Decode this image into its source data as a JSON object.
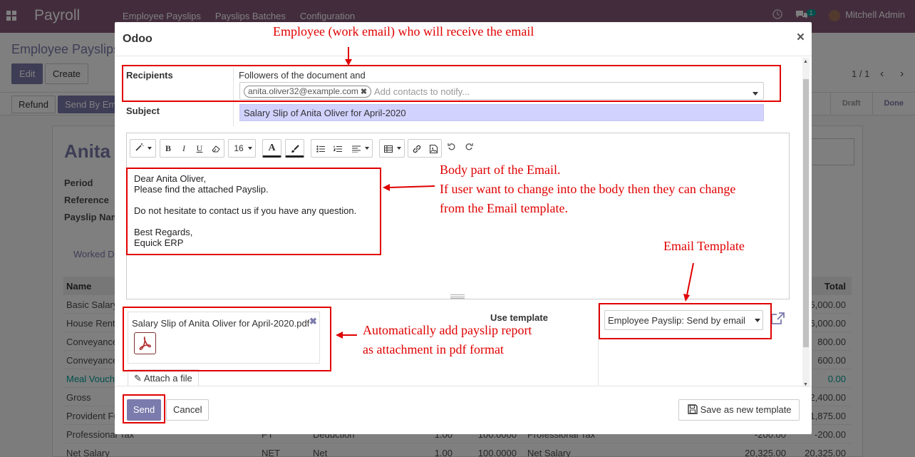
{
  "app": {
    "brand": "Payroll",
    "menu": [
      "Employee Payslips",
      "Payslips Batches",
      "Configuration"
    ],
    "chat_count": "1",
    "user": "Mitchell Admin"
  },
  "control_panel": {
    "breadcrumb": "Employee Payslips",
    "edit_label": "Edit",
    "create_label": "Create",
    "pager": "1 / 1"
  },
  "status_bar": {
    "refund_label": "Refund",
    "send_label": "Send By Email",
    "states": [
      "Draft",
      "Done"
    ],
    "active_state": "Done"
  },
  "sheet": {
    "employee_name": "Anita",
    "labels": [
      "Period",
      "Reference",
      "Payslip Name"
    ],
    "tab_label": "Worked Days",
    "lines_header": {
      "name": "Name",
      "total": "Total"
    },
    "lines": [
      {
        "name": "Basic Salary",
        "code": "",
        "category": "",
        "qty": "",
        "rate": "",
        "rule": "",
        "amount": "",
        "total": "15,000.00"
      },
      {
        "name": "House Rent",
        "code": "",
        "category": "",
        "qty": "",
        "rate": "",
        "rule": "",
        "amount": "",
        "total": "6,000.00"
      },
      {
        "name": "Conveyance",
        "code": "",
        "category": "",
        "qty": "",
        "rate": "",
        "rule": "",
        "amount": "",
        "total": "800.00"
      },
      {
        "name": "Conveyance",
        "code": "",
        "category": "",
        "qty": "",
        "rate": "",
        "rule": "",
        "amount": "",
        "total": "600.00"
      },
      {
        "name": "Meal Voucher",
        "code": "",
        "category": "",
        "qty": "",
        "rate": "",
        "rule": "",
        "amount": "",
        "total": "0.00",
        "link": true
      },
      {
        "name": "Gross",
        "code": "",
        "category": "",
        "qty": "",
        "rate": "",
        "rule": "",
        "amount": "",
        "total": "22,400.00"
      },
      {
        "name": "Provident Fund",
        "code": "",
        "category": "",
        "qty": "",
        "rate": "",
        "rule": "",
        "amount": "",
        "total": "-1,875.00"
      },
      {
        "name": "Professional Tax",
        "code": "PT",
        "category": "Deduction",
        "qty": "1.00",
        "rate": "100.0000",
        "rule": "Professional Tax",
        "amount": "-200.00",
        "total": "-200.00"
      },
      {
        "name": "Net Salary",
        "code": "NET",
        "category": "Net",
        "qty": "1.00",
        "rate": "100.0000",
        "rule": "Net Salary",
        "amount": "20,325.00",
        "total": "20,325.00"
      }
    ]
  },
  "dialog": {
    "title": "Odoo",
    "recipients_label": "Recipients",
    "followers_text": "Followers of the document and",
    "recipient_tag": "anita.oliver32@example.com",
    "recipient_placeholder": "Add contacts to notify...",
    "subject_label": "Subject",
    "subject_value": "Salary Slip of Anita Oliver for April-2020",
    "font_size": "16",
    "body_lines": [
      "Dear Anita Oliver,",
      "Please find the attached Payslip.",
      "",
      "Do not hesitate to contact us if you have any question.",
      "",
      "Best Regards,",
      "Equick ERP"
    ],
    "attachment_name": "Salary Slip of Anita Oliver for April-2020.pdf",
    "attach_file_label": "Attach a file",
    "use_template_label": "Use template",
    "template_value": "Employee Payslip: Send by email",
    "send_label": "Send",
    "cancel_label": "Cancel",
    "save_template_label": "Save as new template"
  },
  "annotations": {
    "recipient_note": "Employee (work email) who will receive the email",
    "body_note": [
      "Body part of the Email.",
      "If user want to change into the body then they can change",
      "from the Email template."
    ],
    "template_note": "Email Template",
    "attachment_note": [
      "Automatically add payslip report",
      "as attachment in pdf format"
    ]
  },
  "colors": {
    "brand": "#875a7b",
    "primary": "#7c7bad",
    "annotation": "#e00000",
    "subject_bg": "#d2d2ff"
  }
}
